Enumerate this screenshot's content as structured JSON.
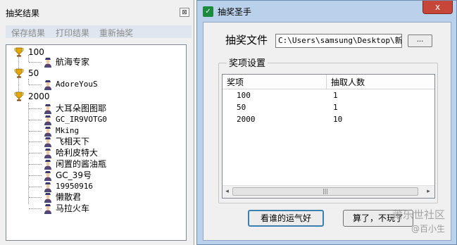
{
  "left_panel": {
    "title": "抽奖结果",
    "close_glyph": "⊠",
    "toolbar": {
      "save_label": "保存结果",
      "print_label": "打印结果",
      "redraw_label": "重新抽奖"
    },
    "tree": {
      "groups": [
        {
          "label": "100",
          "children": [
            "航海专家"
          ]
        },
        {
          "label": "50",
          "children": [
            "AdoreYouS"
          ]
        },
        {
          "label": "2000",
          "children": [
            "大耳朵图图耶",
            "GC_IR9VOTG0",
            "Mking",
            "飞相天下",
            "哈利皮特大",
            "闲置的酱油瓶",
            "GC_39号",
            "19950916",
            "懒散君",
            "马拉火车"
          ]
        }
      ]
    }
  },
  "window": {
    "title": "抽奖圣手",
    "app_icon_glyph": "✓",
    "close_glyph": "x",
    "file_label": "抽奖文件",
    "file_path": "C:\\Users\\samsung\\Desktop\\新建",
    "browse_label": "...",
    "group_title": "奖项设置",
    "table": {
      "headers": [
        "奖项",
        "抽取人数"
      ],
      "rows": [
        [
          "100",
          "1"
        ],
        [
          "50",
          "1"
        ],
        [
          "2000",
          "10"
        ]
      ]
    },
    "scroll_left": "◂",
    "scroll_right": "▸",
    "scroll_grip": "|||",
    "lucky_button": "看谁的运气好",
    "quit_button": "算了，不玩了"
  },
  "watermark": {
    "line1": "莆乐世社区",
    "line2": "@百小生"
  },
  "colors": {
    "titlebar": "#b9d1ea",
    "close_red": "#c7463a",
    "trophy": "#e0a800",
    "panel_bg": "#f0f0f0"
  }
}
